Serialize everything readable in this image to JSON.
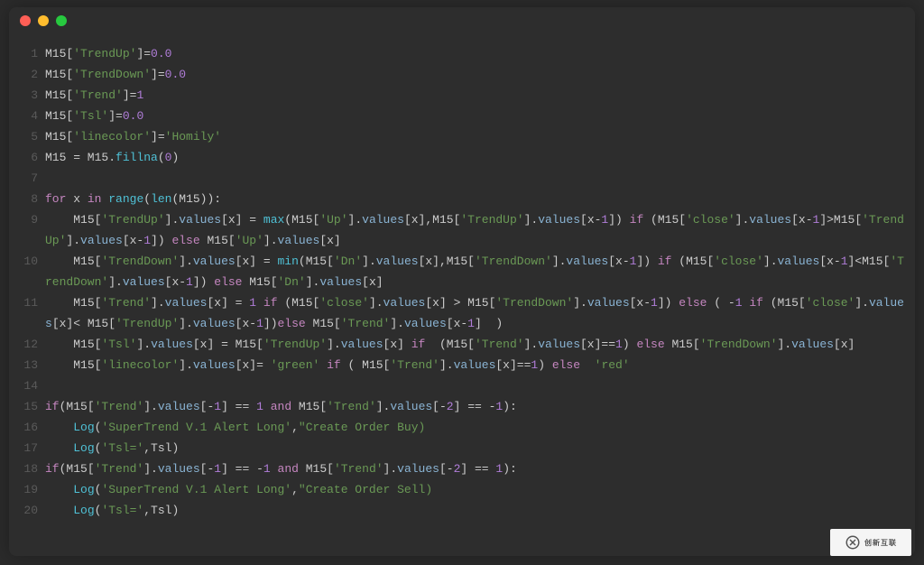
{
  "window": {
    "buttons": [
      "close",
      "minimize",
      "zoom"
    ]
  },
  "lines": [
    {
      "n": 1,
      "tokens": [
        [
          "var",
          "M15["
        ],
        [
          "string",
          "'TrendUp'"
        ],
        [
          "var",
          "]="
        ],
        [
          "number",
          "0.0"
        ]
      ]
    },
    {
      "n": 2,
      "tokens": [
        [
          "var",
          "M15["
        ],
        [
          "string",
          "'TrendDown'"
        ],
        [
          "var",
          "]="
        ],
        [
          "number",
          "0.0"
        ]
      ]
    },
    {
      "n": 3,
      "tokens": [
        [
          "var",
          "M15["
        ],
        [
          "string",
          "'Trend'"
        ],
        [
          "var",
          "]="
        ],
        [
          "number",
          "1"
        ]
      ]
    },
    {
      "n": 4,
      "tokens": [
        [
          "var",
          "M15["
        ],
        [
          "string",
          "'Tsl'"
        ],
        [
          "var",
          "]="
        ],
        [
          "number",
          "0.0"
        ]
      ]
    },
    {
      "n": 5,
      "tokens": [
        [
          "var",
          "M15["
        ],
        [
          "string",
          "'linecolor'"
        ],
        [
          "var",
          "]="
        ],
        [
          "string",
          "'Homily'"
        ]
      ]
    },
    {
      "n": 6,
      "tokens": [
        [
          "var",
          "M15 = M15."
        ],
        [
          "builtin",
          "fillna"
        ],
        [
          "var",
          "("
        ],
        [
          "number",
          "0"
        ],
        [
          "var",
          ")"
        ]
      ]
    },
    {
      "n": 7,
      "tokens": [
        [
          "var",
          ""
        ]
      ]
    },
    {
      "n": 8,
      "tokens": [
        [
          "keyword",
          "for"
        ],
        [
          "var",
          " x "
        ],
        [
          "keyword",
          "in"
        ],
        [
          "var",
          " "
        ],
        [
          "builtin",
          "range"
        ],
        [
          "var",
          "("
        ],
        [
          "builtin",
          "len"
        ],
        [
          "var",
          "(M15)):"
        ]
      ]
    },
    {
      "n": 9,
      "tokens": [
        [
          "var",
          "    M15["
        ],
        [
          "string",
          "'TrendUp'"
        ],
        [
          "var",
          "]."
        ],
        [
          "attr",
          "values"
        ],
        [
          "var",
          "[x] = "
        ],
        [
          "builtin",
          "max"
        ],
        [
          "var",
          "(M15["
        ],
        [
          "string",
          "'Up'"
        ],
        [
          "var",
          "]."
        ],
        [
          "attr",
          "values"
        ],
        [
          "var",
          "[x],M15["
        ],
        [
          "string",
          "'TrendUp'"
        ],
        [
          "var",
          "]."
        ],
        [
          "attr",
          "values"
        ],
        [
          "var",
          "[x-"
        ],
        [
          "number",
          "1"
        ],
        [
          "var",
          "]) "
        ],
        [
          "keyword",
          "if"
        ],
        [
          "var",
          " (M15["
        ],
        [
          "string",
          "'close'"
        ],
        [
          "var",
          "]."
        ],
        [
          "attr",
          "values"
        ],
        [
          "var",
          "[x-"
        ],
        [
          "number",
          "1"
        ],
        [
          "var",
          "]>M15["
        ],
        [
          "string",
          "'TrendUp'"
        ],
        [
          "var",
          "]."
        ],
        [
          "attr",
          "values"
        ],
        [
          "var",
          "[x-"
        ],
        [
          "number",
          "1"
        ],
        [
          "var",
          "]) "
        ],
        [
          "keyword",
          "else"
        ],
        [
          "var",
          " M15["
        ],
        [
          "string",
          "'Up'"
        ],
        [
          "var",
          "]."
        ],
        [
          "attr",
          "values"
        ],
        [
          "var",
          "[x]"
        ]
      ]
    },
    {
      "n": 10,
      "tokens": [
        [
          "var",
          "    M15["
        ],
        [
          "string",
          "'TrendDown'"
        ],
        [
          "var",
          "]."
        ],
        [
          "attr",
          "values"
        ],
        [
          "var",
          "[x] = "
        ],
        [
          "builtin",
          "min"
        ],
        [
          "var",
          "(M15["
        ],
        [
          "string",
          "'Dn'"
        ],
        [
          "var",
          "]."
        ],
        [
          "attr",
          "values"
        ],
        [
          "var",
          "[x],M15["
        ],
        [
          "string",
          "'TrendDown'"
        ],
        [
          "var",
          "]."
        ],
        [
          "attr",
          "values"
        ],
        [
          "var",
          "[x-"
        ],
        [
          "number",
          "1"
        ],
        [
          "var",
          "]) "
        ],
        [
          "keyword",
          "if"
        ],
        [
          "var",
          " (M15["
        ],
        [
          "string",
          "'close'"
        ],
        [
          "var",
          "]."
        ],
        [
          "attr",
          "values"
        ],
        [
          "var",
          "[x-"
        ],
        [
          "number",
          "1"
        ],
        [
          "var",
          "]<M15["
        ],
        [
          "string",
          "'TrendDown'"
        ],
        [
          "var",
          "]."
        ],
        [
          "attr",
          "values"
        ],
        [
          "var",
          "[x-"
        ],
        [
          "number",
          "1"
        ],
        [
          "var",
          "]) "
        ],
        [
          "keyword",
          "else"
        ],
        [
          "var",
          " M15["
        ],
        [
          "string",
          "'Dn'"
        ],
        [
          "var",
          "]."
        ],
        [
          "attr",
          "values"
        ],
        [
          "var",
          "[x]"
        ]
      ]
    },
    {
      "n": 11,
      "tokens": [
        [
          "var",
          "    M15["
        ],
        [
          "string",
          "'Trend'"
        ],
        [
          "var",
          "]."
        ],
        [
          "attr",
          "values"
        ],
        [
          "var",
          "[x] = "
        ],
        [
          "number",
          "1"
        ],
        [
          "var",
          " "
        ],
        [
          "keyword",
          "if"
        ],
        [
          "var",
          " (M15["
        ],
        [
          "string",
          "'close'"
        ],
        [
          "var",
          "]."
        ],
        [
          "attr",
          "values"
        ],
        [
          "var",
          "[x] > M15["
        ],
        [
          "string",
          "'TrendDown'"
        ],
        [
          "var",
          "]."
        ],
        [
          "attr",
          "values"
        ],
        [
          "var",
          "[x-"
        ],
        [
          "number",
          "1"
        ],
        [
          "var",
          "]) "
        ],
        [
          "keyword",
          "else"
        ],
        [
          "var",
          " ( -"
        ],
        [
          "number",
          "1"
        ],
        [
          "var",
          " "
        ],
        [
          "keyword",
          "if"
        ],
        [
          "var",
          " (M15["
        ],
        [
          "string",
          "'close'"
        ],
        [
          "var",
          "]."
        ],
        [
          "attr",
          "values"
        ],
        [
          "var",
          "[x]< M15["
        ],
        [
          "string",
          "'TrendUp'"
        ],
        [
          "var",
          "]."
        ],
        [
          "attr",
          "values"
        ],
        [
          "var",
          "[x-"
        ],
        [
          "number",
          "1"
        ],
        [
          "var",
          "])"
        ],
        [
          "keyword",
          "else"
        ],
        [
          "var",
          " M15["
        ],
        [
          "string",
          "'Trend'"
        ],
        [
          "var",
          "]."
        ],
        [
          "attr",
          "values"
        ],
        [
          "var",
          "[x-"
        ],
        [
          "number",
          "1"
        ],
        [
          "var",
          "]  )"
        ]
      ]
    },
    {
      "n": 12,
      "tokens": [
        [
          "var",
          "    M15["
        ],
        [
          "string",
          "'Tsl'"
        ],
        [
          "var",
          "]."
        ],
        [
          "attr",
          "values"
        ],
        [
          "var",
          "[x] = M15["
        ],
        [
          "string",
          "'TrendUp'"
        ],
        [
          "var",
          "]."
        ],
        [
          "attr",
          "values"
        ],
        [
          "var",
          "[x] "
        ],
        [
          "keyword",
          "if"
        ],
        [
          "var",
          "  (M15["
        ],
        [
          "string",
          "'Trend'"
        ],
        [
          "var",
          "]."
        ],
        [
          "attr",
          "values"
        ],
        [
          "var",
          "[x]=="
        ],
        [
          "number",
          "1"
        ],
        [
          "var",
          ") "
        ],
        [
          "keyword",
          "else"
        ],
        [
          "var",
          " M15["
        ],
        [
          "string",
          "'TrendDown'"
        ],
        [
          "var",
          "]."
        ],
        [
          "attr",
          "values"
        ],
        [
          "var",
          "[x]"
        ]
      ]
    },
    {
      "n": 13,
      "tokens": [
        [
          "var",
          "    M15["
        ],
        [
          "string",
          "'linecolor'"
        ],
        [
          "var",
          "]."
        ],
        [
          "attr",
          "values"
        ],
        [
          "var",
          "[x]= "
        ],
        [
          "string",
          "'green'"
        ],
        [
          "var",
          " "
        ],
        [
          "keyword",
          "if"
        ],
        [
          "var",
          " ( M15["
        ],
        [
          "string",
          "'Trend'"
        ],
        [
          "var",
          "]."
        ],
        [
          "attr",
          "values"
        ],
        [
          "var",
          "[x]=="
        ],
        [
          "number",
          "1"
        ],
        [
          "var",
          ") "
        ],
        [
          "keyword",
          "else"
        ],
        [
          "var",
          "  "
        ],
        [
          "string",
          "'red'"
        ]
      ]
    },
    {
      "n": 14,
      "tokens": [
        [
          "var",
          ""
        ]
      ]
    },
    {
      "n": 15,
      "tokens": [
        [
          "keyword",
          "if"
        ],
        [
          "var",
          "(M15["
        ],
        [
          "string",
          "'Trend'"
        ],
        [
          "var",
          "]."
        ],
        [
          "attr",
          "values"
        ],
        [
          "var",
          "[-"
        ],
        [
          "number",
          "1"
        ],
        [
          "var",
          "] == "
        ],
        [
          "number",
          "1"
        ],
        [
          "var",
          " "
        ],
        [
          "keyword",
          "and"
        ],
        [
          "var",
          " M15["
        ],
        [
          "string",
          "'Trend'"
        ],
        [
          "var",
          "]."
        ],
        [
          "attr",
          "values"
        ],
        [
          "var",
          "[-"
        ],
        [
          "number",
          "2"
        ],
        [
          "var",
          "] == -"
        ],
        [
          "number",
          "1"
        ],
        [
          "var",
          "):"
        ]
      ]
    },
    {
      "n": 16,
      "tokens": [
        [
          "var",
          "    "
        ],
        [
          "builtin",
          "Log"
        ],
        [
          "var",
          "("
        ],
        [
          "string",
          "'SuperTrend V.1 Alert Long'"
        ],
        [
          "var",
          ","
        ],
        [
          "string",
          "\"Create Order Buy)"
        ]
      ]
    },
    {
      "n": 17,
      "tokens": [
        [
          "var",
          "    "
        ],
        [
          "builtin",
          "Log"
        ],
        [
          "var",
          "("
        ],
        [
          "string",
          "'Tsl='"
        ],
        [
          "var",
          ",Tsl)"
        ]
      ]
    },
    {
      "n": 18,
      "tokens": [
        [
          "keyword",
          "if"
        ],
        [
          "var",
          "(M15["
        ],
        [
          "string",
          "'Trend'"
        ],
        [
          "var",
          "]."
        ],
        [
          "attr",
          "values"
        ],
        [
          "var",
          "[-"
        ],
        [
          "number",
          "1"
        ],
        [
          "var",
          "] == -"
        ],
        [
          "number",
          "1"
        ],
        [
          "var",
          " "
        ],
        [
          "keyword",
          "and"
        ],
        [
          "var",
          " M15["
        ],
        [
          "string",
          "'Trend'"
        ],
        [
          "var",
          "]."
        ],
        [
          "attr",
          "values"
        ],
        [
          "var",
          "[-"
        ],
        [
          "number",
          "2"
        ],
        [
          "var",
          "] == "
        ],
        [
          "number",
          "1"
        ],
        [
          "var",
          "):"
        ]
      ]
    },
    {
      "n": 19,
      "tokens": [
        [
          "var",
          "    "
        ],
        [
          "builtin",
          "Log"
        ],
        [
          "var",
          "("
        ],
        [
          "string",
          "'SuperTrend V.1 Alert Long'"
        ],
        [
          "var",
          ","
        ],
        [
          "string",
          "\"Create Order Sell)"
        ]
      ]
    },
    {
      "n": 20,
      "tokens": [
        [
          "var",
          "    "
        ],
        [
          "builtin",
          "Log"
        ],
        [
          "var",
          "("
        ],
        [
          "string",
          "'Tsl='"
        ],
        [
          "var",
          ",Tsl)"
        ]
      ]
    }
  ],
  "logo_text": "创新互联"
}
